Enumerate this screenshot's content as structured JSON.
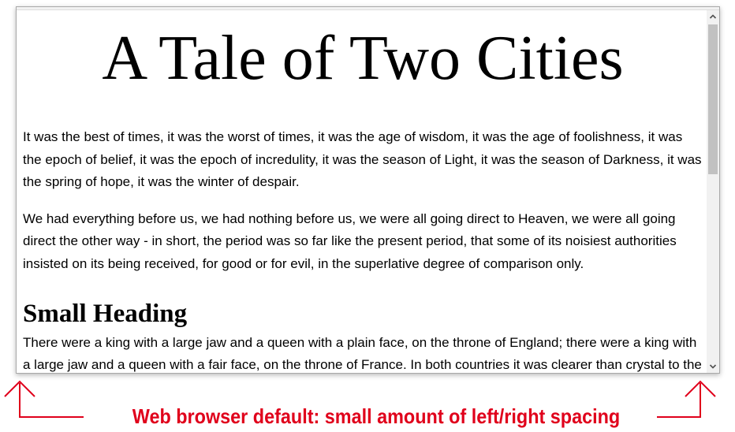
{
  "page": {
    "title": "A Tale of Two Cities",
    "paragraphs": [
      "It was the best of times, it was the worst of times, it was the age of wisdom, it was the age of foolishness, it was the epoch of belief, it was the epoch of incredulity, it was the season of Light, it was the season of Darkness, it was the spring of hope, it was the winter of despair.",
      "We had everything before us, we had nothing before us, we were all going direct to Heaven, we were all going direct the other way - in short, the period was so far like the present period, that some of its noisiest authorities insisted on its being received, for good or for evil, in the superlative degree of comparison only."
    ],
    "section_heading": "Small Heading",
    "section_paragraph": "There were a king with a large jaw and a queen with a plain face, on the throne of England; there were a king with a large jaw and a queen with a fair face, on the throne of France. In both countries it was clearer than crystal to the lords of the State preserves of loaves and fishes, that things in general were settled for ever."
  },
  "annotation": {
    "caption": "Web browser default: small amount of left/right spacing",
    "color": "#e0001b"
  },
  "icons": {
    "scroll_up": "chevron-up-icon",
    "scroll_down": "chevron-down-icon",
    "left_arrow": "arrow-up-left-icon",
    "right_arrow": "arrow-up-right-icon"
  }
}
